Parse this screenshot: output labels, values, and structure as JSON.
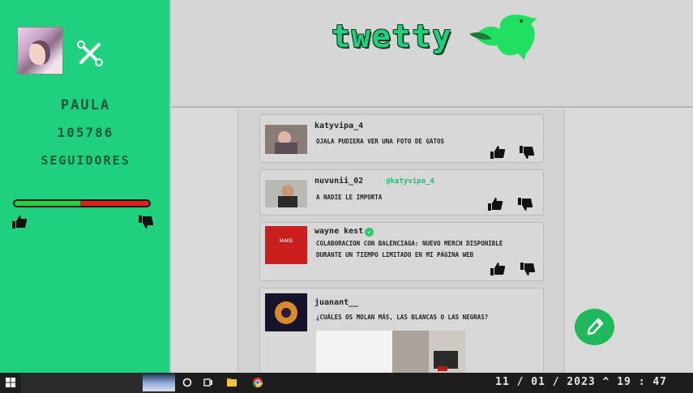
{
  "sidebar": {
    "name": "PAULA",
    "follower_count": "105786",
    "follower_label": "SEGUIDORES",
    "like_ratio": 0.49
  },
  "header": {
    "brand": "twetty"
  },
  "posts": [
    {
      "username": "katyvipa_4",
      "text": "OJALA PUDIERA VER UNA FOTO DE GATOS",
      "mention": ""
    },
    {
      "username": "nuvunii_02",
      "mention": "@katyvipa_4",
      "text": "A NADIE LE IMPORTA"
    },
    {
      "username": "wayne kest",
      "verified": true,
      "text": "COLABORACION CON BALENCIAGA: NUEVO MERCH DISPONIBLE DURANTE UN TIEMPO LIMITADO EN MI PÁGINA WEB"
    },
    {
      "username": "juanant__",
      "text": "¿CUÁLES OS MOLAN MÁS, LAS BLANCAS O LAS NEGRAS?"
    }
  ],
  "taskbar": {
    "clock": "11 / 01 / 2023 ^ 19 : 47"
  },
  "colors": {
    "accent": "#1fd07f",
    "dislike": "#e0201a",
    "like": "#25d04a"
  }
}
